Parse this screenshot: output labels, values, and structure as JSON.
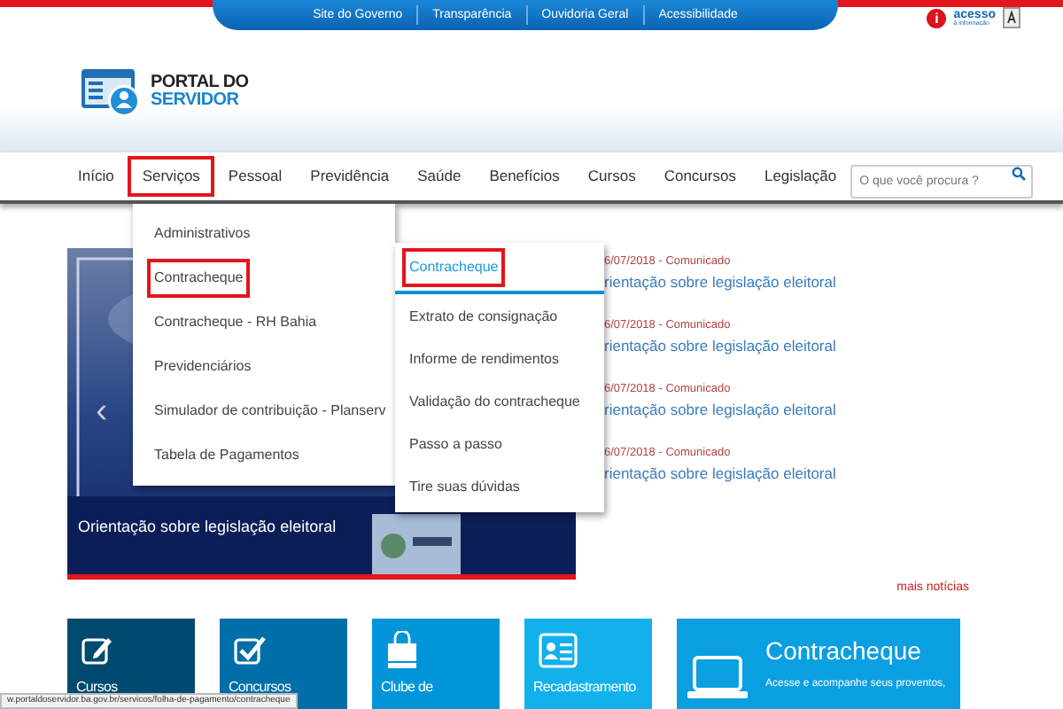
{
  "top_bar": {
    "links": [
      "Site do Governo",
      "Transparência",
      "Ouvidoria Geral",
      "Acessibilidade"
    ]
  },
  "header": {
    "logo": {
      "line_1": "PORTAL DO",
      "line_2": "SERVIDOR"
    },
    "access_badge": {
      "mark": "i",
      "title": "acesso",
      "subtitle": "à informação"
    }
  },
  "nav": {
    "items": [
      {
        "label": "Início",
        "highlighted": false
      },
      {
        "label": "Serviços",
        "highlighted": true
      },
      {
        "label": "Pessoal",
        "highlighted": false
      },
      {
        "label": "Previdência",
        "highlighted": false
      },
      {
        "label": "Saúde",
        "highlighted": false
      },
      {
        "label": "Benefícios",
        "highlighted": false
      },
      {
        "label": "Cursos",
        "highlighted": false
      },
      {
        "label": "Concursos",
        "highlighted": false
      },
      {
        "label": "Legislação",
        "highlighted": false
      }
    ],
    "search": {
      "placeholder": "O que você procura ?"
    }
  },
  "dropdown": {
    "items": [
      {
        "label": "Administrativos",
        "highlighted": false
      },
      {
        "label": "Contracheque",
        "highlighted": true
      },
      {
        "label": "Contracheque - RH Bahia",
        "highlighted": false
      },
      {
        "label": "Previdenciários",
        "highlighted": false
      },
      {
        "label": "Simulador de contribuição - Planserv",
        "highlighted": false
      },
      {
        "label": "Tabela de Pagamentos",
        "highlighted": false
      }
    ]
  },
  "submenu": {
    "items": [
      {
        "label": "Contracheque",
        "selected": true,
        "highlighted": true
      },
      {
        "label": "Extrato de consignação",
        "selected": false,
        "highlighted": false
      },
      {
        "label": "Informe de rendimentos",
        "selected": false,
        "highlighted": false
      },
      {
        "label": "Validação do contracheque",
        "selected": false,
        "highlighted": false
      },
      {
        "label": "Passo a passo",
        "selected": false,
        "highlighted": false
      },
      {
        "label": "Tire suas dúvidas",
        "selected": false,
        "highlighted": false
      }
    ]
  },
  "slider": {
    "kind": "picture",
    "caption": "Orientação sobre legislação eleitoral",
    "prev": "‹"
  },
  "news": {
    "items": [
      {
        "meta": "6/07/2018 - Comunicado",
        "title": "rientação sobre legislação eleitoral"
      },
      {
        "meta": "6/07/2018 - Comunicado",
        "title": "rientação sobre legislação eleitoral"
      },
      {
        "meta": "6/07/2018 - Comunicado",
        "title": "rientação sobre legislação eleitoral"
      },
      {
        "meta": "6/07/2018 - Comunicado",
        "title": "rientação sobre legislação eleitoral"
      }
    ],
    "more_link": "mais notícias"
  },
  "tiles": [
    {
      "kind": "small",
      "title": "Cursos",
      "color": "#004a70"
    },
    {
      "kind": "small",
      "title": "Concursos",
      "color": "#006ea8"
    },
    {
      "kind": "small",
      "title": "Clube de",
      "color": "#0095d9"
    },
    {
      "kind": "small",
      "title": "Recadastramento",
      "color": "#12b1ec"
    },
    {
      "kind": "wide",
      "title": "Contracheque",
      "description": "Acesse e acompanhe seus proventos,",
      "color": "#0a9fe0"
    }
  ],
  "status_bar": {
    "url": "w.portaldoservidor.ba.gov.br/servicos/folha-de-pagamento/contracheque"
  }
}
